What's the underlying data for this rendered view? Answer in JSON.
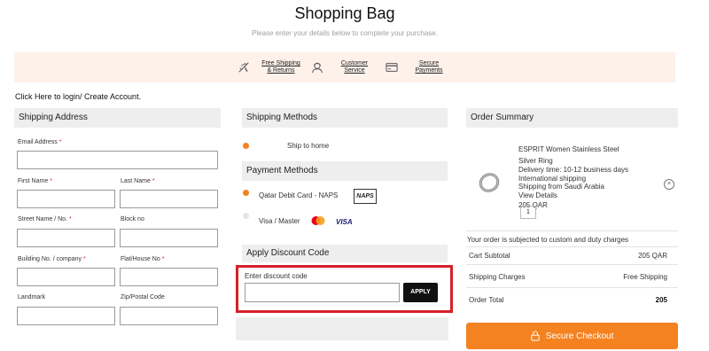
{
  "page": {
    "title": "Shopping Bag",
    "subtitle": "Please enter your details below to complete your purchase."
  },
  "benefits": [
    {
      "label": "Free Shipping\n& Returns",
      "icon": "airplane-icon"
    },
    {
      "label": "Customer\nService",
      "icon": "customer-service-icon"
    },
    {
      "label": "Secure\nPayments",
      "icon": "credit-card-icon"
    }
  ],
  "login": {
    "link_text": "Click Here to login/ Create Account."
  },
  "shipping_address": {
    "header": "Shipping Address",
    "required_mark": "*",
    "fields": {
      "email": "Email Address",
      "first_name": "First Name",
      "last_name": "Last Name",
      "street": "Street Name / No.",
      "block": "Block no",
      "building": "Building No. / company",
      "flat": "Flat/House No",
      "landmark": "Landmark",
      "zip": "Zip/Postal Code"
    }
  },
  "shipping_methods": {
    "header": "Shipping Methods",
    "option": "Ship to home"
  },
  "payment_methods": {
    "header": "Payment Methods",
    "options": [
      {
        "label": "Qatar Debit Card - NAPS",
        "badge": "NAPS"
      },
      {
        "label": "Visa / Master",
        "badge": "VISA"
      }
    ]
  },
  "discount": {
    "header": "Apply Discount Code",
    "label": "Enter discount code",
    "input_value": "",
    "button": "APPLY"
  },
  "order_summary": {
    "header": "Order Summary",
    "item": {
      "name_line1": "ESPRIT Women Stainless Steel",
      "name_line2": "Silver Ring",
      "delivery": "Delivery time: 10-12 business days",
      "intl_line1": "International shipping",
      "intl_line2": "Shipping from Saudi Arabia",
      "view_details": "View Details",
      "price": "205 QAR",
      "quantity": "1",
      "remove_symbol": "×"
    },
    "customs_note": "Your order is subjected to custom and duty charges",
    "rows": [
      {
        "label": "Cart Subtotal",
        "value": "205 QAR"
      },
      {
        "label": "Shipping Charges",
        "value": "Free Shipping"
      },
      {
        "label": "Order Total",
        "value": "205"
      }
    ],
    "checkout_button": "Secure Checkout"
  },
  "colors": {
    "accent": "#f58220",
    "banner_bg": "#fdf1ea",
    "highlight_border": "#d4202a",
    "section_header_bg": "#eeeeee"
  }
}
